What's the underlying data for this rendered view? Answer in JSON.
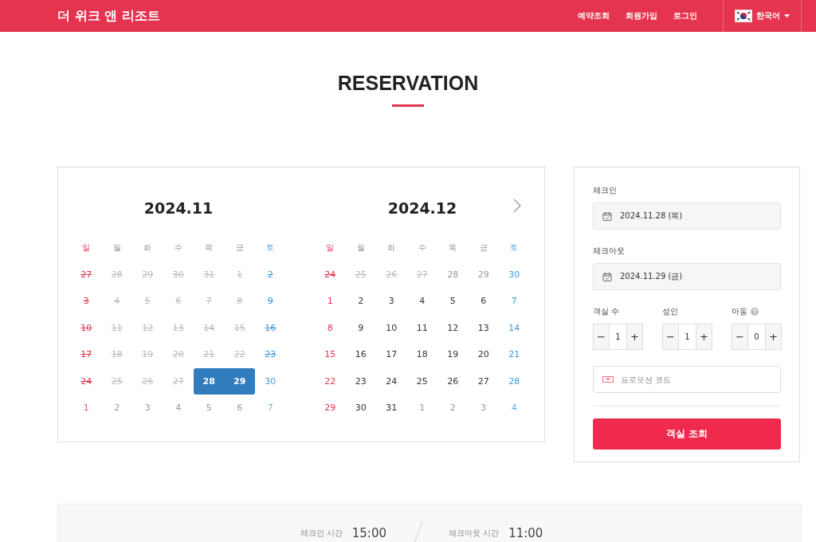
{
  "header": {
    "brand": "더 위크 앤 리조트",
    "nav": [
      "예약조회",
      "회원가입",
      "로그인"
    ],
    "language": "한국어"
  },
  "heading": "RESERVATION",
  "calendar": {
    "months": [
      {
        "title": "2024.11",
        "weekdays": [
          {
            "label": "일",
            "kind": "sun"
          },
          {
            "label": "월",
            "kind": "weekday"
          },
          {
            "label": "화",
            "kind": "weekday"
          },
          {
            "label": "수",
            "kind": "weekday"
          },
          {
            "label": "목",
            "kind": "weekday"
          },
          {
            "label": "금",
            "kind": "weekday"
          },
          {
            "label": "토",
            "kind": "sat"
          }
        ],
        "days": [
          {
            "day": "27",
            "disabled": true,
            "selected": false
          },
          {
            "day": "28",
            "disabled": true,
            "selected": false
          },
          {
            "day": "29",
            "disabled": true,
            "selected": false
          },
          {
            "day": "30",
            "disabled": true,
            "selected": false
          },
          {
            "day": "31",
            "disabled": true,
            "selected": false
          },
          {
            "day": "1",
            "disabled": true,
            "selected": false
          },
          {
            "day": "2",
            "disabled": true,
            "selected": false
          },
          {
            "day": "3",
            "disabled": true,
            "selected": false
          },
          {
            "day": "4",
            "disabled": true,
            "selected": false
          },
          {
            "day": "5",
            "disabled": true,
            "selected": false
          },
          {
            "day": "6",
            "disabled": true,
            "selected": false
          },
          {
            "day": "7",
            "disabled": true,
            "selected": false
          },
          {
            "day": "8",
            "disabled": true,
            "selected": false
          },
          {
            "day": "9",
            "disabled": true,
            "selected": false
          },
          {
            "day": "10",
            "disabled": true,
            "selected": false
          },
          {
            "day": "11",
            "disabled": true,
            "selected": false
          },
          {
            "day": "12",
            "disabled": true,
            "selected": false
          },
          {
            "day": "13",
            "disabled": true,
            "selected": false
          },
          {
            "day": "14",
            "disabled": true,
            "selected": false
          },
          {
            "day": "15",
            "disabled": true,
            "selected": false
          },
          {
            "day": "16",
            "disabled": true,
            "selected": false
          },
          {
            "day": "17",
            "disabled": true,
            "selected": false
          },
          {
            "day": "18",
            "disabled": true,
            "selected": false
          },
          {
            "day": "19",
            "disabled": true,
            "selected": false
          },
          {
            "day": "20",
            "disabled": true,
            "selected": false
          },
          {
            "day": "21",
            "disabled": true,
            "selected": false
          },
          {
            "day": "22",
            "disabled": true,
            "selected": false
          },
          {
            "day": "23",
            "disabled": true,
            "selected": false
          },
          {
            "day": "24",
            "disabled": true,
            "selected": false
          },
          {
            "day": "25",
            "disabled": true,
            "selected": false
          },
          {
            "day": "26",
            "disabled": true,
            "selected": false
          },
          {
            "day": "27",
            "disabled": true,
            "selected": false
          },
          {
            "day": "28",
            "disabled": false,
            "other_month": false,
            "selected": true
          },
          {
            "day": "29",
            "disabled": false,
            "other_month": false,
            "selected": true
          },
          {
            "day": "30",
            "disabled": false,
            "other_month": false,
            "selected": false
          },
          {
            "day": "1",
            "disabled": false,
            "other_month": true,
            "selected": false
          },
          {
            "day": "2",
            "disabled": false,
            "other_month": true,
            "selected": false
          },
          {
            "day": "3",
            "disabled": false,
            "other_month": true,
            "selected": false
          },
          {
            "day": "4",
            "disabled": false,
            "other_month": true,
            "selected": false
          },
          {
            "day": "5",
            "disabled": false,
            "other_month": true,
            "selected": false
          },
          {
            "day": "6",
            "disabled": false,
            "other_month": true,
            "selected": false
          },
          {
            "day": "7",
            "disabled": false,
            "other_month": true,
            "selected": false
          }
        ]
      },
      {
        "title": "2024.12",
        "weekdays": [
          {
            "label": "일",
            "kind": "sun"
          },
          {
            "label": "월",
            "kind": "weekday"
          },
          {
            "label": "화",
            "kind": "weekday"
          },
          {
            "label": "수",
            "kind": "weekday"
          },
          {
            "label": "목",
            "kind": "weekday"
          },
          {
            "label": "금",
            "kind": "weekday"
          },
          {
            "label": "토",
            "kind": "sat"
          }
        ],
        "days": [
          {
            "day": "24",
            "disabled": true,
            "selected": false
          },
          {
            "day": "25",
            "disabled": true,
            "selected": false
          },
          {
            "day": "26",
            "disabled": true,
            "selected": false
          },
          {
            "day": "27",
            "disabled": true,
            "selected": false
          },
          {
            "day": "28",
            "disabled": false,
            "other_month": true,
            "selected": false
          },
          {
            "day": "29",
            "disabled": false,
            "other_month": true,
            "selected": false
          },
          {
            "day": "30",
            "disabled": false,
            "other_month": false,
            "selected": false
          },
          {
            "day": "1",
            "disabled": false,
            "other_month": false,
            "selected": false
          },
          {
            "day": "2",
            "disabled": false,
            "other_month": false,
            "selected": false
          },
          {
            "day": "3",
            "disabled": false,
            "other_month": false,
            "selected": false
          },
          {
            "day": "4",
            "disabled": false,
            "other_month": false,
            "selected": false
          },
          {
            "day": "5",
            "disabled": false,
            "other_month": false,
            "selected": false
          },
          {
            "day": "6",
            "disabled": false,
            "other_month": false,
            "selected": false
          },
          {
            "day": "7",
            "disabled": false,
            "other_month": false,
            "selected": false
          },
          {
            "day": "8",
            "disabled": false,
            "other_month": false,
            "selected": false
          },
          {
            "day": "9",
            "disabled": false,
            "other_month": false,
            "selected": false
          },
          {
            "day": "10",
            "disabled": false,
            "other_month": false,
            "selected": false
          },
          {
            "day": "11",
            "disabled": false,
            "other_month": false,
            "selected": false
          },
          {
            "day": "12",
            "disabled": false,
            "other_month": false,
            "selected": false
          },
          {
            "day": "13",
            "disabled": false,
            "other_month": false,
            "selected": false
          },
          {
            "day": "14",
            "disabled": false,
            "other_month": false,
            "selected": false
          },
          {
            "day": "15",
            "disabled": false,
            "other_month": false,
            "selected": false
          },
          {
            "day": "16",
            "disabled": false,
            "other_month": false,
            "selected": false
          },
          {
            "day": "17",
            "disabled": false,
            "other_month": false,
            "selected": false
          },
          {
            "day": "18",
            "disabled": false,
            "other_month": false,
            "selected": false
          },
          {
            "day": "19",
            "disabled": false,
            "other_month": false,
            "selected": false
          },
          {
            "day": "20",
            "disabled": false,
            "other_month": false,
            "selected": false
          },
          {
            "day": "21",
            "disabled": false,
            "other_month": false,
            "selected": false
          },
          {
            "day": "22",
            "disabled": false,
            "other_month": false,
            "selected": false
          },
          {
            "day": "23",
            "disabled": false,
            "other_month": false,
            "selected": false
          },
          {
            "day": "24",
            "disabled": false,
            "other_month": false,
            "selected": false
          },
          {
            "day": "25",
            "disabled": false,
            "other_month": false,
            "selected": false
          },
          {
            "day": "26",
            "disabled": false,
            "other_month": false,
            "selected": false
          },
          {
            "day": "27",
            "disabled": false,
            "other_month": false,
            "selected": false
          },
          {
            "day": "28",
            "disabled": false,
            "other_month": false,
            "selected": false
          },
          {
            "day": "29",
            "disabled": false,
            "other_month": false,
            "selected": false
          },
          {
            "day": "30",
            "disabled": false,
            "other_month": false,
            "selected": false
          },
          {
            "day": "31",
            "disabled": false,
            "other_month": false,
            "selected": false
          },
          {
            "day": "1",
            "disabled": false,
            "other_month": true,
            "selected": false
          },
          {
            "day": "2",
            "disabled": false,
            "other_month": true,
            "selected": false
          },
          {
            "day": "3",
            "disabled": false,
            "other_month": true,
            "selected": false
          },
          {
            "day": "4",
            "disabled": false,
            "other_month": true,
            "selected": false
          }
        ]
      }
    ]
  },
  "booking": {
    "checkin": {
      "label": "체크인",
      "value": "2024.11.28 (목)"
    },
    "checkout": {
      "label": "체크아웃",
      "value": "2024.11.29 (금)"
    },
    "steppers": [
      {
        "label": "객실 수",
        "value": "1",
        "help": false,
        "minus": "−",
        "plus": "+"
      },
      {
        "label": "성인",
        "value": "1",
        "help": false,
        "minus": "−",
        "plus": "+"
      },
      {
        "label": "아동",
        "value": "0",
        "help": true,
        "minus": "−",
        "plus": "+"
      }
    ],
    "promo": {
      "placeholder": "프로모션 코드"
    },
    "search_button": "객실 조회"
  },
  "times": [
    {
      "label": "체크인 시간",
      "value": "15:00"
    },
    {
      "label": "체크아웃 시간",
      "value": "11:00"
    }
  ]
}
